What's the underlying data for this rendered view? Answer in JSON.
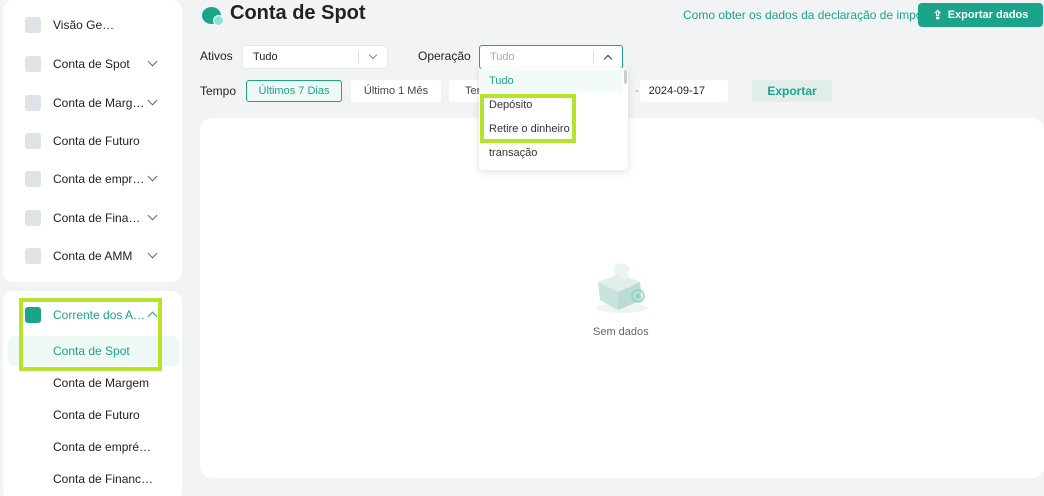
{
  "sidebar": {
    "items": [
      {
        "label": "Visão Ge…",
        "icon": "overview-icon",
        "has_chevron": false
      },
      {
        "label": "Conta de Spot",
        "icon": "spot-wallet-icon",
        "has_chevron": true
      },
      {
        "label": "Conta de Marg…",
        "icon": "margin-percent-icon",
        "has_chevron": true
      },
      {
        "label": "Conta de Futuro",
        "icon": "futures-icon",
        "has_chevron": false
      },
      {
        "label": "Conta de empr…",
        "icon": "loan-icon",
        "has_chevron": true
      },
      {
        "label": "Conta de Fina…",
        "icon": "finance-icon",
        "has_chevron": true
      },
      {
        "label": "Conta de AMM",
        "icon": "amm-icon",
        "has_chevron": true
      }
    ],
    "section": {
      "label": "Corrente dos A…",
      "icon": "statement-icon",
      "expanded": true
    },
    "sub_items": [
      {
        "label": "Conta de Spot",
        "selected": true
      },
      {
        "label": "Conta de Margem",
        "selected": false
      },
      {
        "label": "Conta de Futuro",
        "selected": false
      },
      {
        "label": "Conta de empré…",
        "selected": false
      },
      {
        "label": "Conta de Financ…",
        "selected": false
      }
    ]
  },
  "header": {
    "title": "Conta de Spot",
    "tax_link": "Como obter os dados da declaração de imposto?",
    "export_data_label": "Exportar dados"
  },
  "filters": {
    "assets_label": "Ativos",
    "assets_value": "Tudo",
    "operation_label": "Operação",
    "operation_placeholder": "Tudo",
    "time_label": "Tempo",
    "time_buttons": [
      "Últimos 7 Dias",
      "Último 1 Mês",
      "Ter"
    ],
    "time_active": "Últimos 7 Dias",
    "date_separator": "-",
    "end_date": "2024-09-17",
    "export_label": "Exportar"
  },
  "operation_dropdown": {
    "options": [
      "Tudo",
      "Depósito",
      "Retire o dinheiro",
      "transação"
    ],
    "selected": "Tudo"
  },
  "content": {
    "empty_text": "Sem dados"
  },
  "colors": {
    "accent": "#1ba48a",
    "highlight": "#b6e32b",
    "background": "#f2f3f5"
  }
}
